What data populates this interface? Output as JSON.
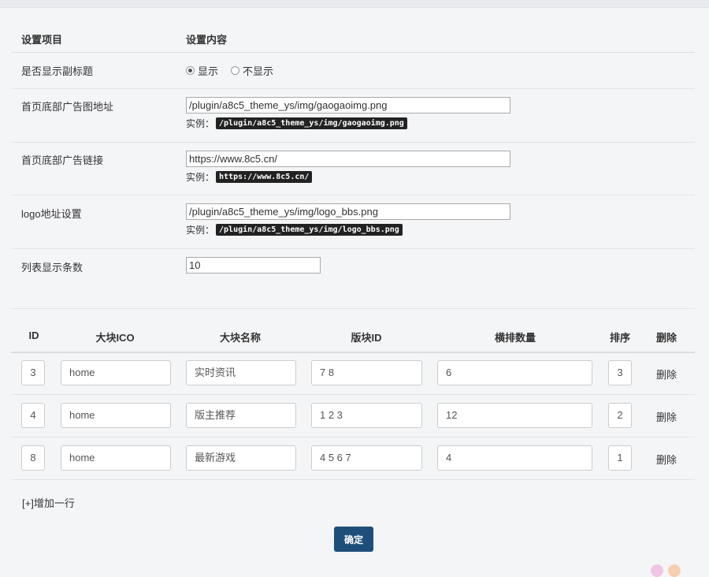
{
  "settings": {
    "header": {
      "item": "设置项目",
      "content": "设置内容"
    },
    "subtitle": {
      "label": "是否显示副标题",
      "options": [
        "显示",
        "不显示"
      ],
      "selected": 0
    },
    "ad_image": {
      "label": "首页底部广告图地址",
      "value": "/plugin/a8c5_theme_ys/img/gaogaoimg.png",
      "example_prefix": "实例：",
      "example": "/plugin/a8c5_theme_ys/img/gaogaoimg.png"
    },
    "ad_link": {
      "label": "首页底部广告链接",
      "value": "https://www.8c5.cn/",
      "example_prefix": "实例：",
      "example": "https://www.8c5.cn/"
    },
    "logo": {
      "label": "logo地址设置",
      "value": "/plugin/a8c5_theme_ys/img/logo_bbs.png",
      "example_prefix": "实例：",
      "example": "/plugin/a8c5_theme_ys/img/logo_bbs.png"
    },
    "list_count": {
      "label": "列表显示条数",
      "value": "10"
    }
  },
  "blocks": {
    "columns": [
      "ID",
      "大块ICO",
      "大块名称",
      "版块ID",
      "横排数量",
      "排序",
      "删除"
    ],
    "rows": [
      {
        "id": "3",
        "ico": "home",
        "name": "实时资讯",
        "forum_ids": "7 8",
        "count": "6",
        "order": "3",
        "delete_label": "删除"
      },
      {
        "id": "4",
        "ico": "home",
        "name": "版主推荐",
        "forum_ids": "1 2 3",
        "count": "12",
        "order": "2",
        "delete_label": "删除"
      },
      {
        "id": "8",
        "ico": "home",
        "name": "最新游戏",
        "forum_ids": "4 5 6 7",
        "count": "4",
        "order": "1",
        "delete_label": "删除"
      }
    ],
    "add_row_label": "[+]增加一行"
  },
  "submit_label": "确定",
  "colors": {
    "submit_bg": "#1e4f7b",
    "code_bg": "#222222"
  }
}
